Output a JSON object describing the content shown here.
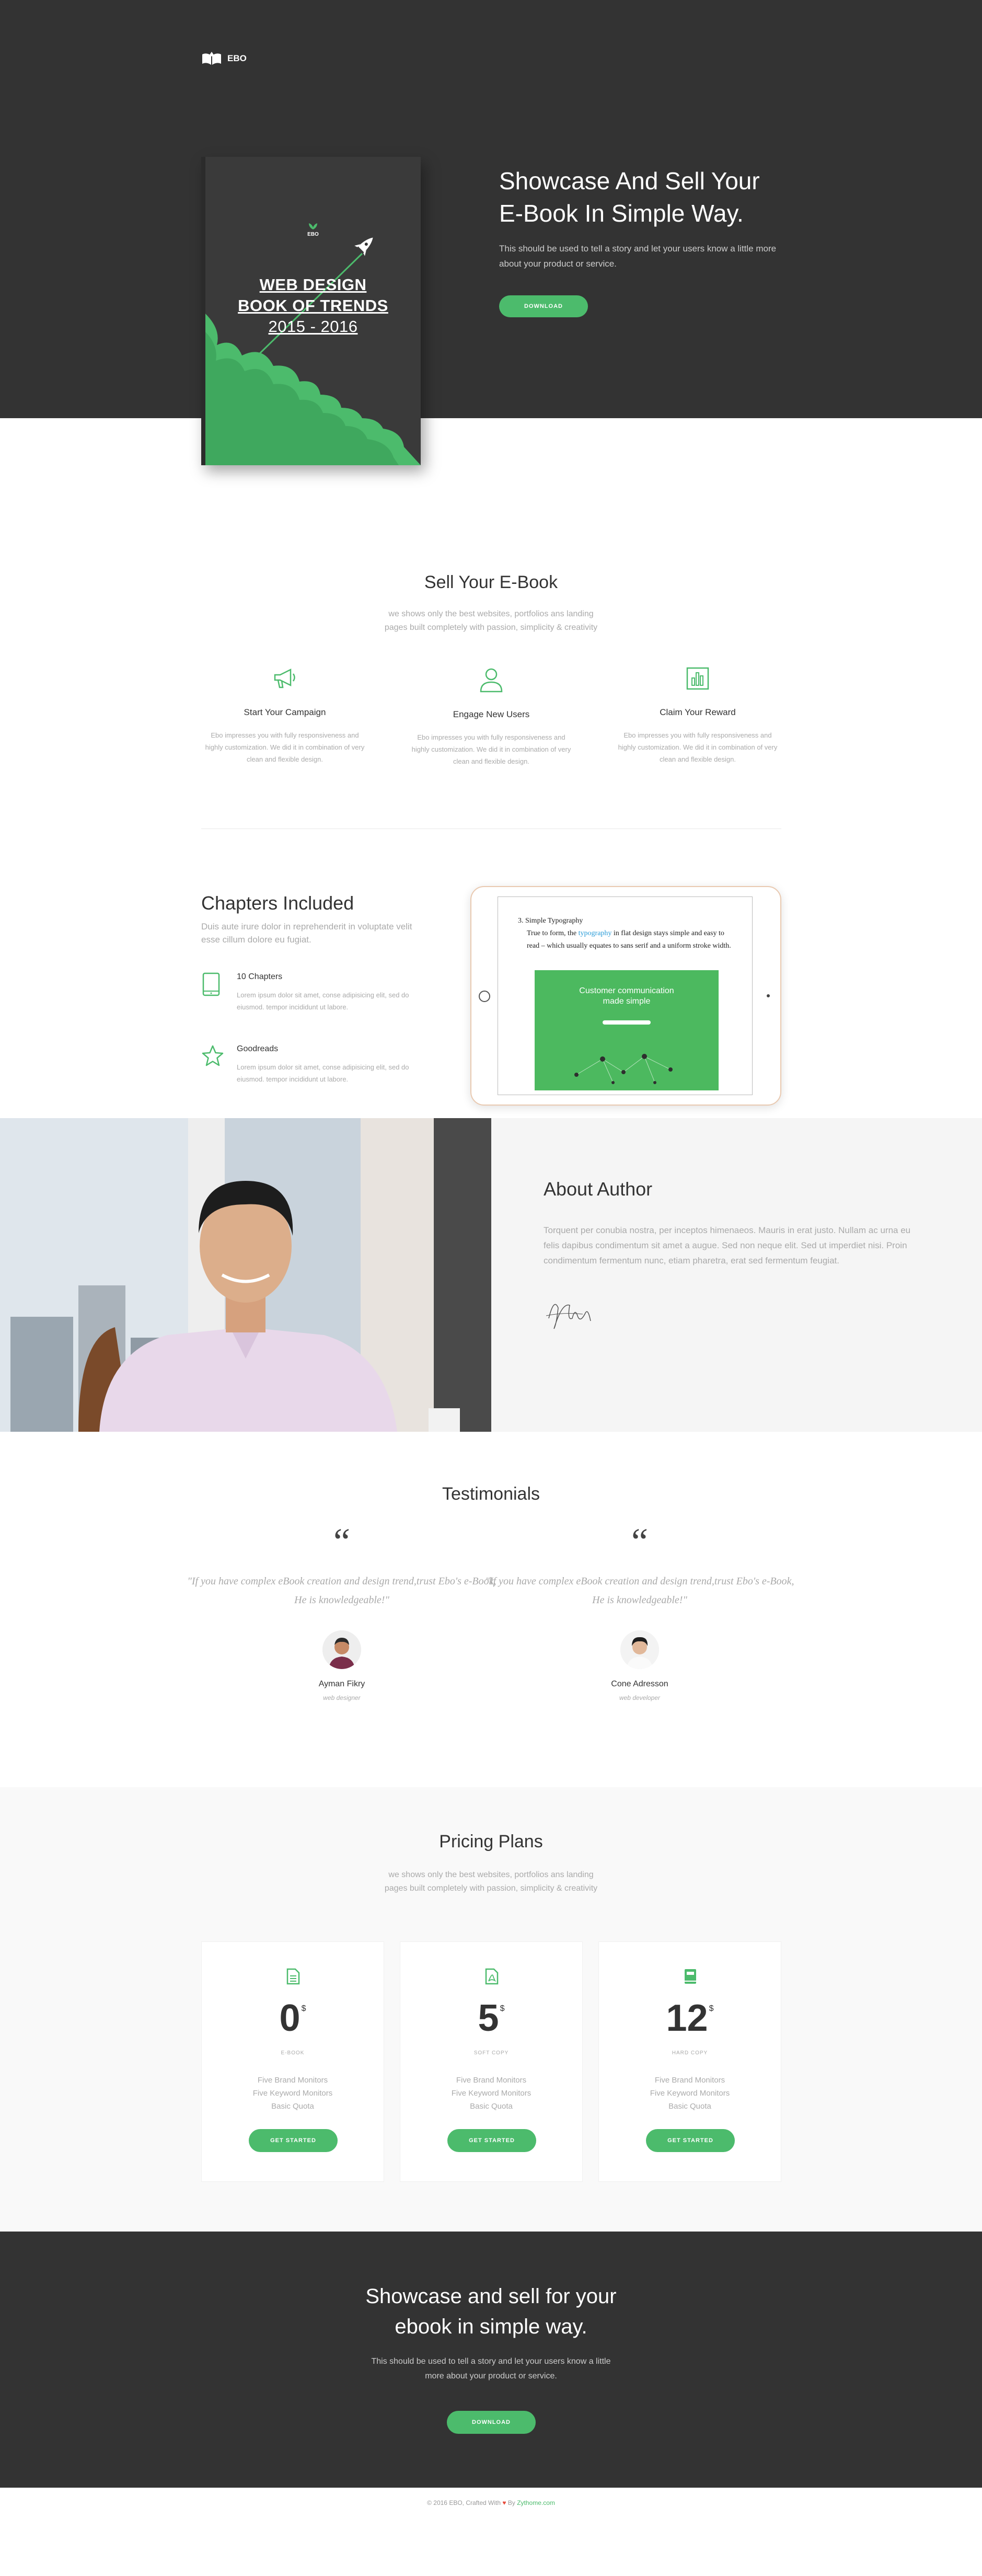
{
  "brand": {
    "name": "EBO",
    "accent": "#4cbb6c",
    "dark": "#333333"
  },
  "hero": {
    "title_line1": "Showcase And Sell Your",
    "title_line2": "E-Book In Simple Way.",
    "text": "This should be used to tell a story and let your users know a little more about your product or service.",
    "button": "DOWNLOAD",
    "book": {
      "brand": "EBO",
      "title_line1": "WEB DESIGN",
      "title_line2": "BOOK OF TRENDS",
      "years": "2015 - 2016"
    }
  },
  "sell": {
    "title": "Sell Your E-Book",
    "subtitle_line1": "we shows only the best websites, portfolios ans landing",
    "subtitle_line2": "pages built completely with passion, simplicity & creativity",
    "features": [
      {
        "icon": "megaphone-icon",
        "title": "Start Your Campaign",
        "desc": "Ebo impresses you with fully responsiveness and highly customization. We did it in combination of very clean and flexible design."
      },
      {
        "icon": "user-icon",
        "title": "Engage New Users",
        "desc": "Ebo impresses you with fully responsiveness and highly customization. We did it in combination of very clean and flexible design."
      },
      {
        "icon": "chart-icon",
        "title": "Claim Your Reward",
        "desc": "Ebo impresses you with fully responsiveness and highly customization. We did it in combination of very clean and flexible design."
      }
    ]
  },
  "chapters": {
    "title": "Chapters Included",
    "subtitle": "Duis aute irure dolor in reprehenderit in voluptate velit esse cillum dolore eu fugiat.",
    "items": [
      {
        "icon": "tablet-icon",
        "title": "10 Chapters",
        "desc": "Lorem ipsum dolor sit amet, conse adipisicing elit, sed do eiusmod. tempor incididunt ut labore."
      },
      {
        "icon": "star-icon",
        "title": "Goodreads",
        "desc": "Lorem ipsum dolor sit amet, conse adipisicing elit, sed do eiusmod. tempor incididunt ut labore."
      }
    ],
    "tablet": {
      "heading": "3. Simple Typography",
      "body_pre": "True to form, the ",
      "body_link": "typography",
      "body_post": " in flat design stays simple and easy to read – which usually equates to sans serif and a uniform stroke width.",
      "shot_title_line1": "Customer communication",
      "shot_title_line2": "made simple"
    }
  },
  "author": {
    "title": "About Author",
    "text": "Torquent per conubia nostra, per inceptos himenaeos. Mauris in erat justo. Nullam ac urna eu felis dapibus condimentum sit amet a augue. Sed non neque elit. Sed ut imperdiet nisi. Proin condimentum fermentum nunc, etiam pharetra, erat sed fermentum feugiat."
  },
  "testimonials": {
    "title": "Testimonials",
    "items": [
      {
        "quote": "\"If you have complex eBook creation and design trend,trust Ebo's e-Book, He is knowledgeable!\"",
        "name": "Ayman Fikry",
        "role": "web designer"
      },
      {
        "quote": "\"If you have complex eBook creation and design trend,trust Ebo's e-Book, He is knowledgeable!\"",
        "name": "Cone Adresson",
        "role": "web developer"
      }
    ]
  },
  "pricing": {
    "title": "Pricing Plans",
    "subtitle_line1": "we shows only the best websites, portfolios ans landing",
    "subtitle_line2": "pages built completely with passion, simplicity & creativity",
    "plans": [
      {
        "icon": "document-icon",
        "price": "0",
        "currency": "$",
        "name": "E-BOOK",
        "features": [
          "Five Brand Monitors",
          "Five Keyword Monitors",
          "Basic Quota"
        ],
        "button": "GET STARTED"
      },
      {
        "icon": "pdf-icon",
        "price": "5",
        "currency": "$",
        "name": "SOFT COPY",
        "features": [
          "Five Brand Monitors",
          "Five Keyword Monitors",
          "Basic Quota"
        ],
        "button": "GET STARTED"
      },
      {
        "icon": "book-icon",
        "price": "12",
        "currency": "$",
        "name": "HARD COPY",
        "features": [
          "Five Brand Monitors",
          "Five Keyword Monitors",
          "Basic Quota"
        ],
        "button": "GET STARTED"
      }
    ]
  },
  "cta": {
    "title_line1": "Showcase and sell for your",
    "title_line2": "ebook in simple way.",
    "text_line1": "This should be used to tell a story and let your users know a little",
    "text_line2": "more about your product or service.",
    "button": "DOWNLOAD"
  },
  "footer": {
    "prefix": "© 2016 EBO, Crafted With",
    "by": "By",
    "link": "Zythome.com"
  }
}
